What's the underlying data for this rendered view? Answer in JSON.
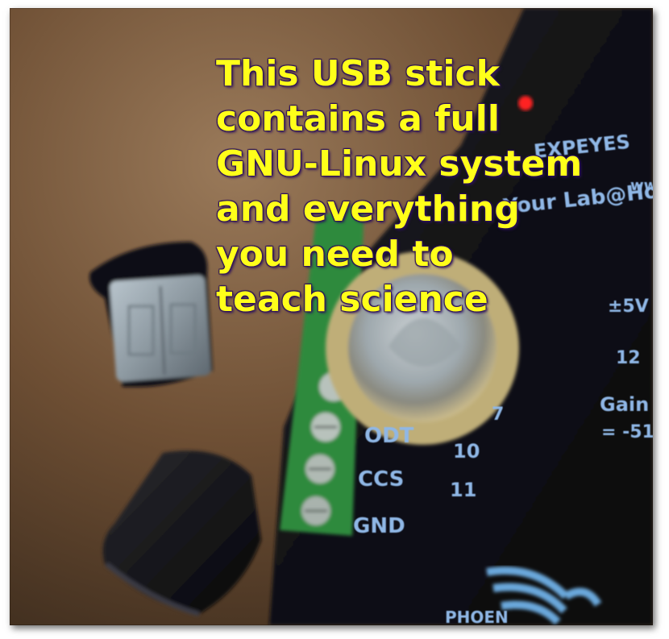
{
  "caption": {
    "lines": [
      "This USB stick",
      "contains a full",
      "GNU-Linux system",
      "and everything",
      "you need to",
      "teach science"
    ],
    "color": "#ffff1a",
    "outline_color": "#2a0f5a"
  },
  "board": {
    "brand": "EXPEYES",
    "tagline": "Your Lab@Home",
    "url_fragment": "www",
    "voltage": "±5V",
    "pin_12": "12",
    "gain_label": "Gain",
    "gain_value": "= -51",
    "pin_7": "7",
    "odt_label": "ODT",
    "odt_pin": "10",
    "ccs_label": "CCS",
    "ccs_pin": "11",
    "gnd_label": "GND",
    "maker_fragment": "PHOEN"
  },
  "objects": {
    "usb_stick": "usb-stick",
    "usb_cap": "usb-cap",
    "coin": "euro-coin",
    "terminal_strip": "green-terminal-strip",
    "red_led": "#ff2020"
  }
}
